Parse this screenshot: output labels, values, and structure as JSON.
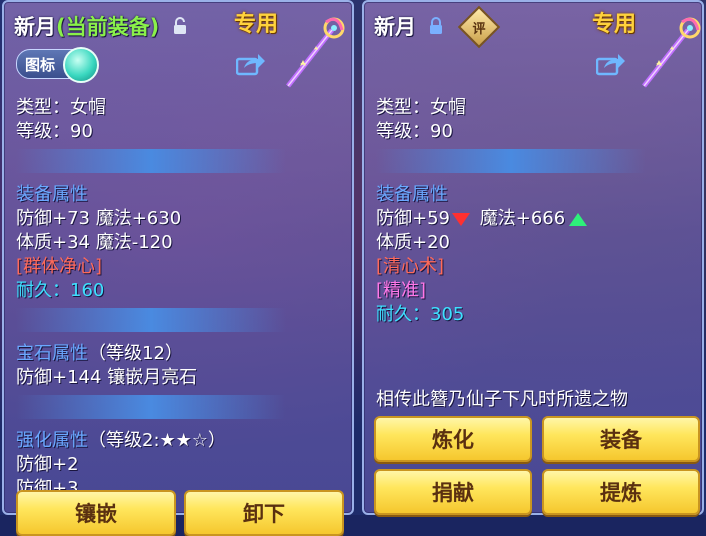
{
  "left_panel": {
    "item_name": "新月",
    "equip_state": "(当前装备)",
    "special_tag": "专用",
    "icon_toggle_label": "图标",
    "type_line": "类型：女帽",
    "level_line": "等级：90",
    "equip_attr_title": "装备属性",
    "attr_line_1": "防御+73 魔法+630",
    "attr_line_2": "体质+34 魔法-120",
    "skill": "[群体净心]",
    "durability_label": "耐久：",
    "durability_value": "160",
    "gem_attr_title": "宝石属性",
    "gem_level": "（等级12）",
    "gem_line": "防御+144 镶嵌月亮石",
    "enhance_title": "强化属性",
    "enhance_level": "（等级2:★★☆）",
    "enhance_line_1": "防御+2",
    "enhance_line_2": "防御+3",
    "buttons": [
      "镶嵌",
      "卸下"
    ]
  },
  "right_panel": {
    "item_name": "新月",
    "rate_badge": "评",
    "special_tag": "专用",
    "type_line": "类型：女帽",
    "level_line": "等级：90",
    "equip_attr_title": "装备属性",
    "defense": "防御+59",
    "magic": "魔法+666",
    "attr_line_2": "体质+20",
    "skill": "[清心术]",
    "special_effect": "[精准]",
    "durability_label": "耐久：",
    "durability_value": "305",
    "description": "相传此簪乃仙子下凡时所遗之物",
    "buttons": [
      "炼化",
      "装备",
      "捐献",
      "提炼"
    ]
  },
  "colors": {
    "title_green": "#8af04a",
    "section_blue": "#6aa8ff",
    "skill_red": "#ff6a5a",
    "effect_pink": "#ff78e8",
    "durability_cyan": "#3ee0ff",
    "special_gold": "#ffd23c",
    "down_arrow": "#ff3030",
    "up_arrow": "#2ef07a"
  },
  "icons": [
    "unlock-icon",
    "lock-icon",
    "share-icon",
    "staff-icon",
    "toggle-knob",
    "down-arrow-icon",
    "up-arrow-icon"
  ]
}
